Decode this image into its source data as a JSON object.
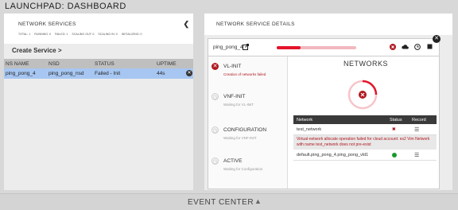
{
  "app": {
    "title": "LAUNCHPAD: DASHBOARD"
  },
  "left_panel": {
    "title": "NETWORK SERVICES",
    "stats": [
      "TOTAL: 1",
      "RUNNING: 0",
      "FAILED: 1",
      "SCALING OUT: 0",
      "SCALING IN: 0",
      "INITIALIZING: 0"
    ],
    "create_label": "Create Service >",
    "columns": [
      "NS NAME",
      "NSD",
      "STATUS",
      "UPTIME"
    ],
    "rows": [
      {
        "name": "ping_pong_4",
        "nsd": "ping_pong_nsd",
        "status": "Failed - Init",
        "uptime": "44s"
      }
    ]
  },
  "right_panel": {
    "title": "NETWORK SERVICE DETAILS",
    "card": {
      "name": "ping_pong_4",
      "progress": 0.3,
      "steps": [
        {
          "name": "VL-INIT",
          "desc": "Creation of networks failed",
          "state": "error"
        },
        {
          "name": "VNF-INIT",
          "desc": "Waiting for VL-INIT",
          "state": "pending"
        },
        {
          "name": "CONFIGURATION",
          "desc": "Waiting for VNF-INIT",
          "state": "pending"
        },
        {
          "name": "ACTIVE",
          "desc": "Waiting for Configuration",
          "state": "pending"
        }
      ],
      "networks_title": "NETWORKS",
      "net_columns": [
        "Network",
        "Status",
        "Record"
      ],
      "networks": [
        {
          "name": "test_network",
          "status": "error"
        },
        {
          "name": "default.ping_pong_4.ping_pong_vld1",
          "status": "ok"
        }
      ],
      "error_message": "Virtual-network allocate operation failed for cloud account: es2 Vim Network with name test_network does not pre-exist"
    }
  },
  "footer": {
    "label": "EVENT CENTER"
  },
  "colors": {
    "error": "#e3142a",
    "ok": "#1a9a2c",
    "selected_row": "#a7c7f2"
  }
}
